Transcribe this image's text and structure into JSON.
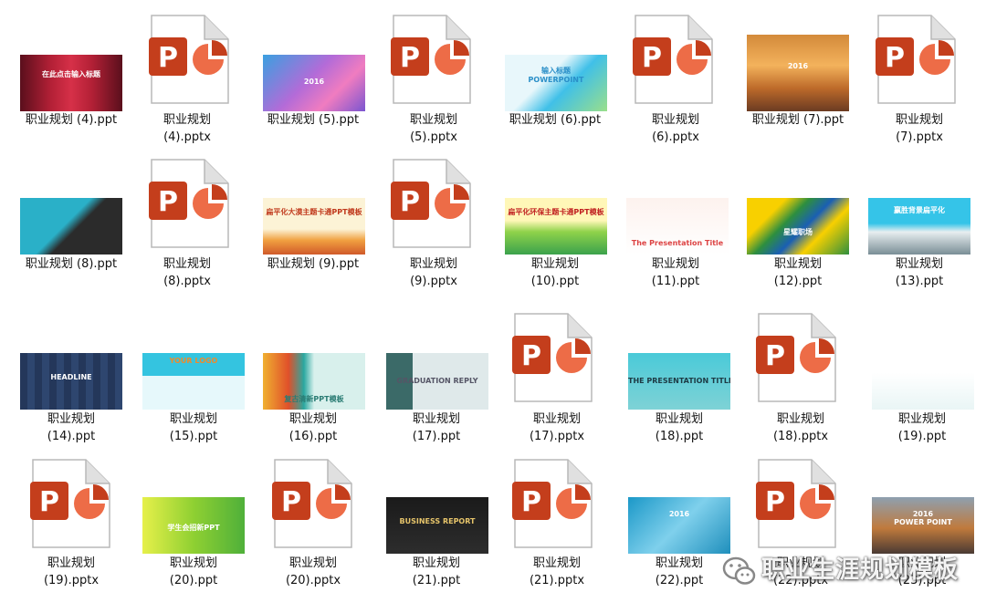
{
  "files": [
    {
      "label": "职业规划 (4).ppt",
      "thumb_text": "在此点击输入标题"
    },
    {
      "label": "职业规划\n(4).pptx"
    },
    {
      "label": "职业规划 (5).ppt",
      "thumb_text": "2016"
    },
    {
      "label": "职业规划\n(5).pptx"
    },
    {
      "label": "职业规划 (6).ppt",
      "thumb_text": "输入标题\nPOWERPOINT"
    },
    {
      "label": "职业规划\n(6).pptx"
    },
    {
      "label": "职业规划 (7).ppt",
      "thumb_text": "2016"
    },
    {
      "label": "职业规划\n(7).pptx"
    },
    {
      "label": "职业规划 (8).ppt"
    },
    {
      "label": "职业规划\n(8).pptx"
    },
    {
      "label": "职业规划 (9).ppt",
      "thumb_text": "扁平化大漠主题卡通PPT模板"
    },
    {
      "label": "职业规划\n(9).pptx"
    },
    {
      "label": "职业规划\n(10).ppt",
      "thumb_text": "扁平化环保主题卡通PPT模板"
    },
    {
      "label": "职业规划\n(11).ppt",
      "thumb_text": "The Presentation Title"
    },
    {
      "label": "职业规划\n(12).ppt",
      "thumb_text": "星耀职场"
    },
    {
      "label": "职业规划\n(13).ppt",
      "thumb_text": "赢胜背景扁平化"
    },
    {
      "label": "职业规划\n(14).ppt",
      "thumb_text": "HEADLINE"
    },
    {
      "label": "职业规划\n(15).ppt",
      "thumb_text": "YOUR LOGO"
    },
    {
      "label": "职业规划\n(16).ppt",
      "thumb_text": "复古清新PPT模板"
    },
    {
      "label": "职业规划\n(17).ppt",
      "thumb_text": "GRADUATION REPLY"
    },
    {
      "label": "职业规划\n(17).pptx"
    },
    {
      "label": "职业规划\n(18).ppt",
      "thumb_text": "THE PRESENTATION TITLE"
    },
    {
      "label": "职业规划\n(18).pptx"
    },
    {
      "label": "职业规划\n(19).ppt"
    },
    {
      "label": "职业规划\n(19).pptx"
    },
    {
      "label": "职业规划\n(20).ppt",
      "thumb_text": "学生会招新PPT"
    },
    {
      "label": "职业规划\n(20).pptx"
    },
    {
      "label": "职业规划\n(21).ppt",
      "thumb_text": "BUSINESS REPORT"
    },
    {
      "label": "职业规划\n(21).pptx"
    },
    {
      "label": "职业规划\n(22).ppt",
      "thumb_text": "2016"
    },
    {
      "label": "职业规划\n(22).pptx"
    },
    {
      "label": "职业规划\n(23).ppt",
      "thumb_text": "2016\nPOWER POINT"
    }
  ],
  "watermark": {
    "text": "职业生涯规划模板",
    "icon": "wechat-icon"
  },
  "colors": {
    "ppt_red": "#c43e1c",
    "ppt_orange": "#ed6c47",
    "page_fold": "#e0e0e0"
  }
}
